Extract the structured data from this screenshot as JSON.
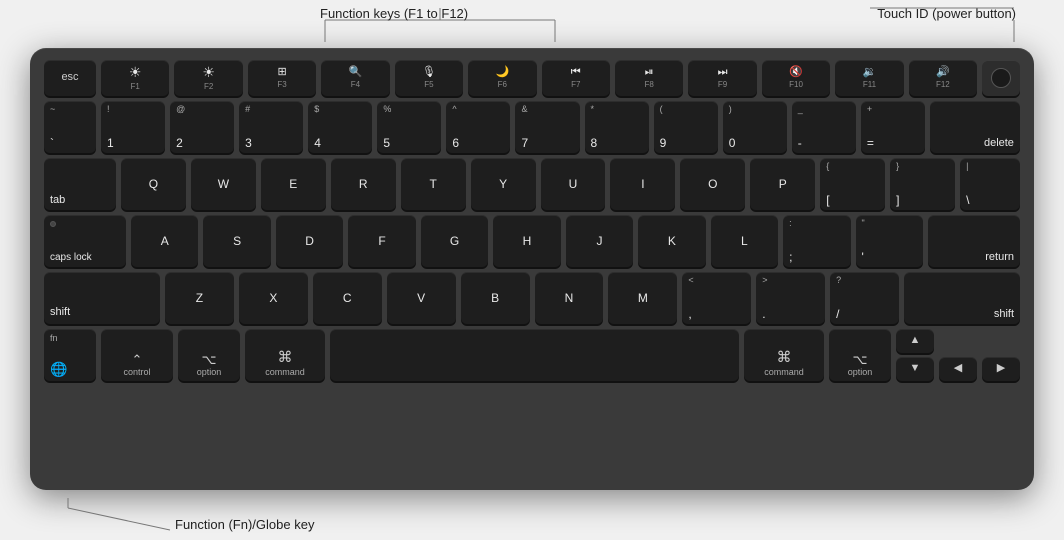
{
  "annotations": {
    "function_keys_label": "Function keys (F1 to F12)",
    "touchid_label": "Touch ID (power button)",
    "fn_globe_label": "Function (Fn)/Globe key"
  },
  "keyboard": {
    "rows": {
      "fn_row": [
        "esc",
        "F1",
        "F2",
        "F3",
        "F4",
        "F5",
        "F6",
        "F7",
        "F8",
        "F9",
        "F10",
        "F11",
        "F12",
        "touch_id"
      ],
      "num_row": [
        "`~",
        "1!",
        "2@",
        "3#",
        "4$",
        "5%",
        "6^",
        "7&",
        "8*",
        "9(",
        "0)",
        "-_",
        "=+",
        "delete"
      ],
      "qwerty_row": [
        "tab",
        "Q",
        "W",
        "E",
        "R",
        "T",
        "Y",
        "U",
        "I",
        "O",
        "P",
        "{[",
        "}]",
        "|\\"
      ],
      "asdf_row": [
        "caps lock",
        "A",
        "S",
        "D",
        "F",
        "G",
        "H",
        "J",
        "K",
        "L",
        ";:",
        "'\"",
        "return"
      ],
      "zxcv_row": [
        "shift",
        "Z",
        "X",
        "C",
        "V",
        "B",
        "N",
        "M",
        ",<",
        ".>",
        "/?",
        "shift"
      ],
      "bottom_row": [
        "fn/globe",
        "control",
        "option",
        "command",
        "space",
        "command",
        "option",
        "arrows"
      ]
    }
  }
}
